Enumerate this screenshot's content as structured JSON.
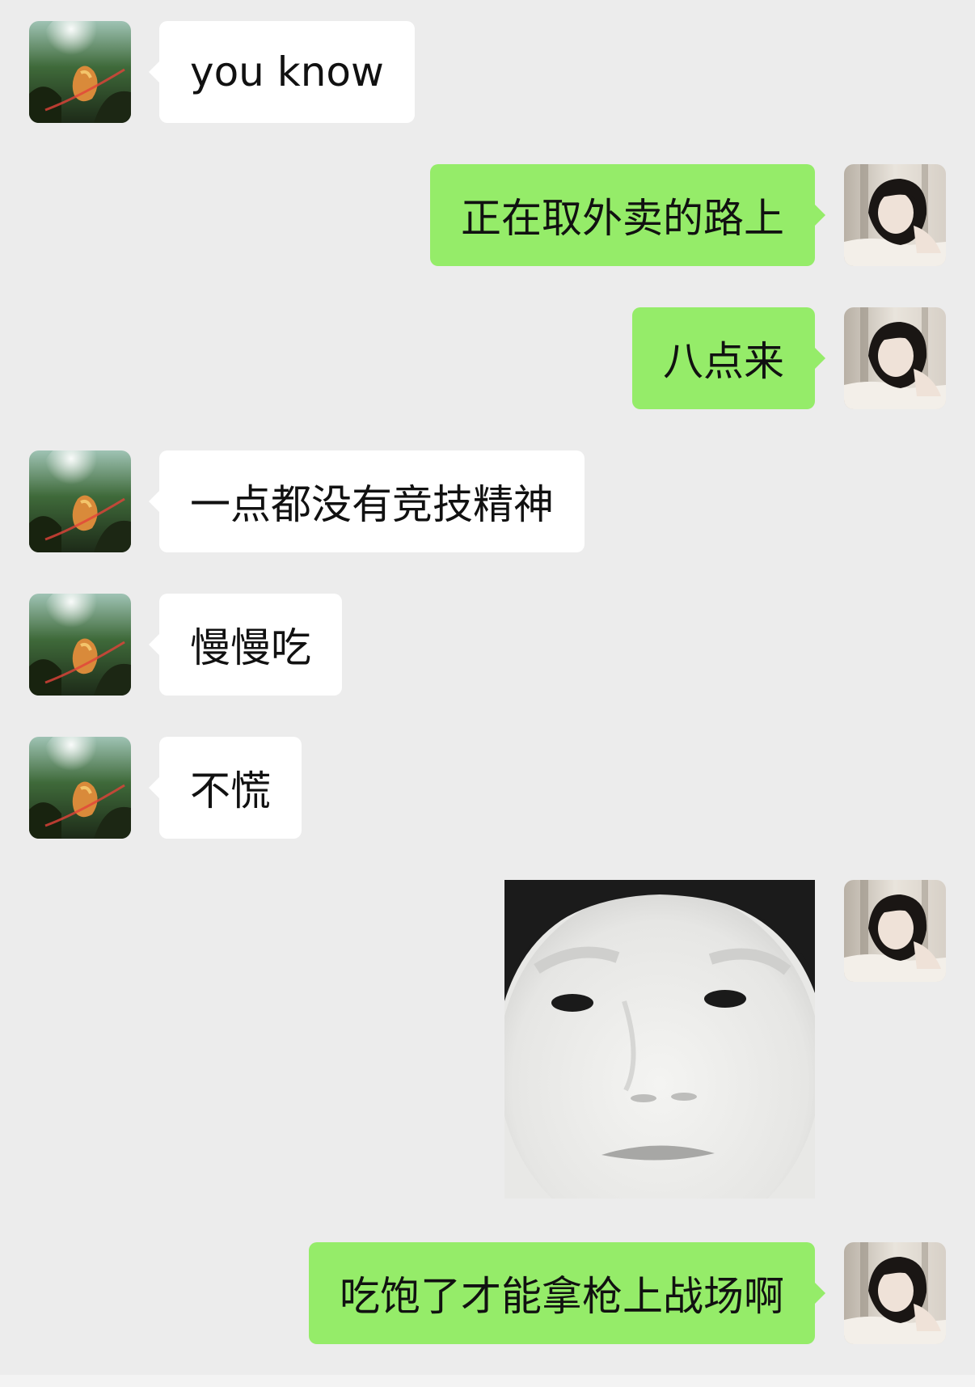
{
  "colors": {
    "background": "#ececec",
    "incoming_bubble": "#ffffff",
    "outgoing_bubble": "#95ec69"
  },
  "messages": [
    {
      "side": "left",
      "type": "text",
      "text": "you know"
    },
    {
      "side": "right",
      "type": "text",
      "text": "正在取外卖的路上"
    },
    {
      "side": "right",
      "type": "text",
      "text": "八点来"
    },
    {
      "side": "left",
      "type": "text",
      "text": "一点都没有竞技精神"
    },
    {
      "side": "left",
      "type": "text",
      "text": "慢慢吃"
    },
    {
      "side": "left",
      "type": "text",
      "text": "不慌"
    },
    {
      "side": "right",
      "type": "sticker",
      "icon": "face-meme-sticker"
    },
    {
      "side": "right",
      "type": "text",
      "text": "吃饱了才能拿枪上战场啊"
    }
  ],
  "avatars": {
    "left": "lion-dance-avatar",
    "right": "girl-portrait-avatar"
  }
}
